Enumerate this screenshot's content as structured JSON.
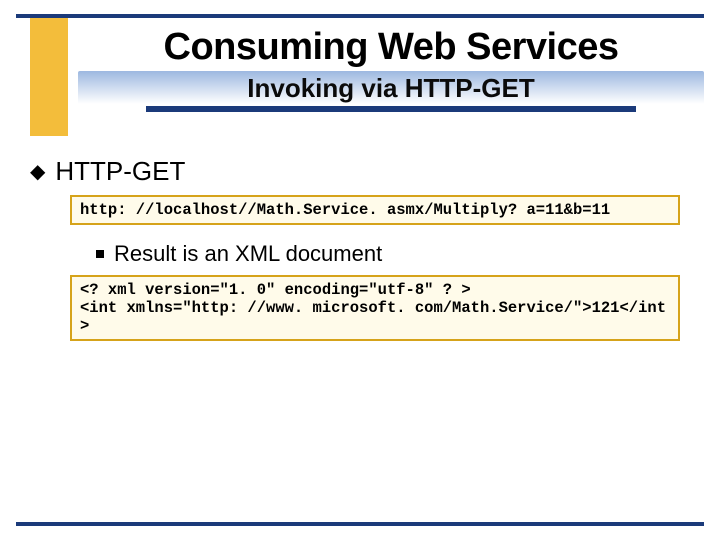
{
  "header": {
    "title": "Consuming Web Services",
    "subtitle": "Invoking via HTTP-GET"
  },
  "body": {
    "bullet1": "HTTP-GET",
    "code1": "http: //localhost//Math.Service. asmx/Multiply? a=11&b=11",
    "sub1": "Result is an XML document",
    "code2": "<? xml version=\"1. 0\" encoding=\"utf-8\" ? >\n<int xmlns=\"http: //www. microsoft. com/Math.Service/\">121</int>"
  }
}
